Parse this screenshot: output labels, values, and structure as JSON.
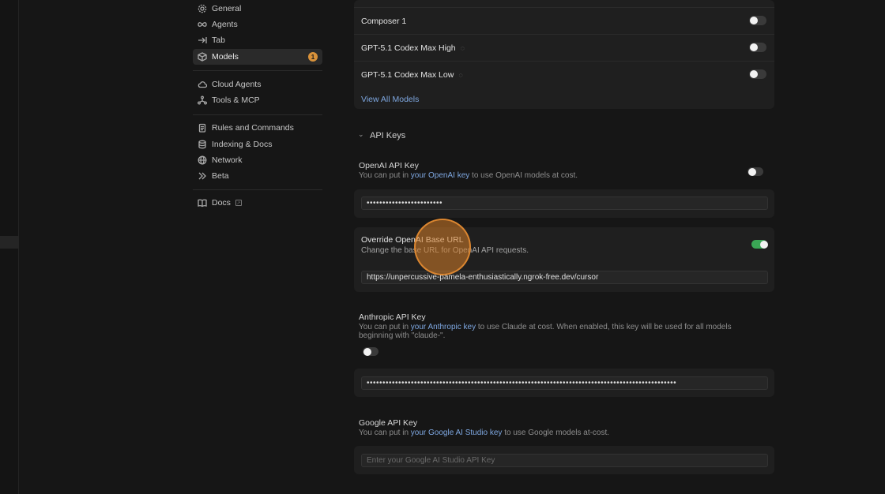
{
  "sidebar": {
    "items": [
      {
        "label": "General",
        "icon": "gear-icon"
      },
      {
        "label": "Agents",
        "icon": "infinity-icon"
      },
      {
        "label": "Tab",
        "icon": "tab-arrow-icon"
      },
      {
        "label": "Models",
        "icon": "cube-icon",
        "badge": "1",
        "active": true
      },
      {
        "label": "Cloud Agents",
        "icon": "cloud-icon"
      },
      {
        "label": "Tools & MCP",
        "icon": "tools-icon"
      },
      {
        "label": "Rules and Commands",
        "icon": "clipboard-icon"
      },
      {
        "label": "Indexing & Docs",
        "icon": "database-icon"
      },
      {
        "label": "Network",
        "icon": "globe-icon"
      },
      {
        "label": "Beta",
        "icon": "chevrons-right-icon"
      },
      {
        "label": "Docs",
        "icon": "book-icon"
      }
    ]
  },
  "models": {
    "rows": [
      {
        "name": "Composer 1",
        "enabled": false
      },
      {
        "name": "GPT-5.1 Codex Max High",
        "enabled": false,
        "reasoning": true
      },
      {
        "name": "GPT-5.1 Codex Max Low",
        "enabled": false,
        "reasoning": true
      }
    ],
    "view_all": "View All Models"
  },
  "api_keys": {
    "section_title": "API Keys",
    "openai": {
      "title": "OpenAI API Key",
      "desc_prefix": "You can put in ",
      "desc_link": "your OpenAI key",
      "desc_suffix": " to use OpenAI models at cost.",
      "enabled": false,
      "value": "••••••••••••••••••••••••"
    },
    "override": {
      "title": "Override OpenAI Base URL",
      "desc": "Change the base URL for OpenAI API requests.",
      "enabled": true,
      "value": "https://unpercussive-pamela-enthusiastically.ngrok-free.dev/cursor"
    },
    "anthropic": {
      "title": "Anthropic API Key",
      "desc_prefix": "You can put in ",
      "desc_link": "your Anthropic key",
      "desc_suffix": " to use Claude at cost. When enabled, this key will be used for all models",
      "desc_line2": "beginning with \"claude-\".",
      "enabled": false,
      "value": "••••••••••••••••••••••••••••••••••••••••••••••••••••••••••••••••••••••••••••••••••••••••••••••••••"
    },
    "google": {
      "title": "Google API Key",
      "desc_prefix": "You can put in ",
      "desc_link": "your Google AI Studio key",
      "desc_suffix": " to use Google models at-cost.",
      "placeholder": "Enter your Google AI Studio API Key"
    }
  },
  "colors": {
    "accent_orange": "#d9923a",
    "toggle_on": "#3aa655",
    "link": "#7ea7e0"
  }
}
